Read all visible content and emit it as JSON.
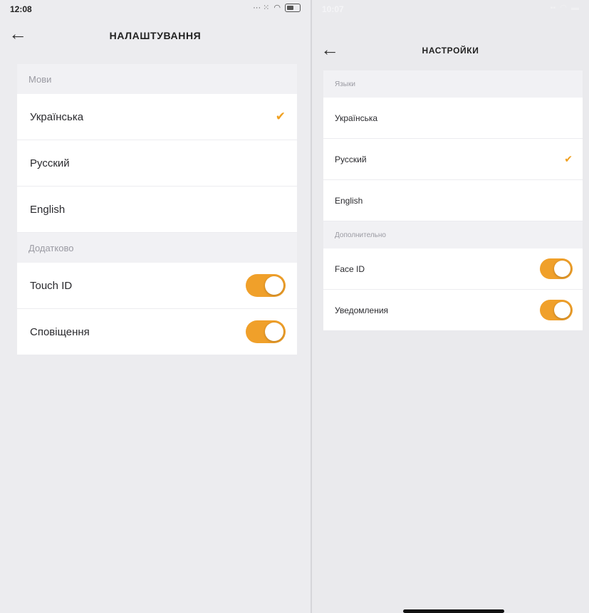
{
  "left": {
    "status": {
      "time": "12:08",
      "signal": "...",
      "battery": ""
    },
    "title": "НАЛАШТУВАННЯ",
    "sections": [
      {
        "header": "Мови",
        "languages": [
          {
            "label": "Українська",
            "checked": true
          },
          {
            "label": "Русский",
            "checked": false
          },
          {
            "label": "English",
            "checked": false
          }
        ]
      },
      {
        "header": "Додатково",
        "toggles": [
          {
            "label": "Touch ID",
            "on": true
          },
          {
            "label": "Сповіщення",
            "on": true
          }
        ]
      }
    ]
  },
  "right": {
    "status": {
      "time": "10:07"
    },
    "title": "НАСТРОЙКИ",
    "sections": [
      {
        "header": "Языки",
        "languages": [
          {
            "label": "Українська",
            "checked": false
          },
          {
            "label": "Русский",
            "checked": true
          },
          {
            "label": "English",
            "checked": false
          }
        ]
      },
      {
        "header": "Дополнительно",
        "toggles": [
          {
            "label": "Face ID",
            "on": true
          },
          {
            "label": "Уведомления",
            "on": true
          }
        ]
      }
    ]
  },
  "icons": {
    "back": "arrow-left-icon",
    "check": "checkmark-icon"
  },
  "colors": {
    "accent": "#f0a02a",
    "background": "#ececef",
    "header_bg": "#f1f1f4"
  }
}
